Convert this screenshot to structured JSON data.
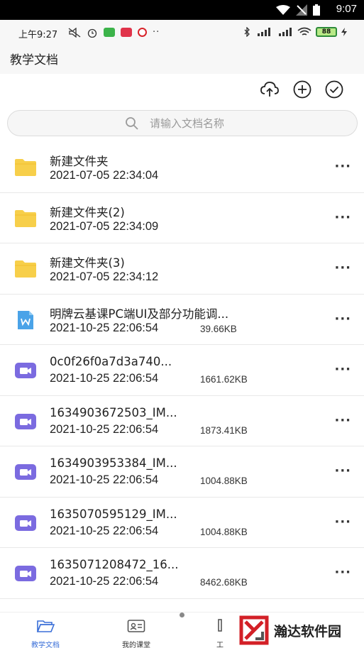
{
  "android_status": {
    "time": "9:07"
  },
  "phone_status": {
    "time": "上午9:27",
    "more": "··",
    "battery": "88"
  },
  "header": {
    "title": "教学文档"
  },
  "toolbar": {
    "upload_icon": "cloud-upload-icon",
    "add_icon": "plus-circle-icon",
    "select_icon": "check-circle-icon"
  },
  "search": {
    "placeholder": "请输入文档名称"
  },
  "files": [
    {
      "name": "新建文件夹",
      "date": "2021-07-05 22:34:04",
      "size": "",
      "type": "folder"
    },
    {
      "name": "新建文件夹(2)",
      "date": "2021-07-05 22:34:09",
      "size": "",
      "type": "folder"
    },
    {
      "name": "新建文件夹(3)",
      "date": "2021-07-05 22:34:12",
      "size": "",
      "type": "folder"
    },
    {
      "name": "明牌云基课PC端UI及部分功能调...",
      "date": "2021-10-25 22:06:54",
      "size": "39.66KB",
      "type": "word"
    },
    {
      "name": "0c0f26f0a7d3a740...",
      "date": "2021-10-25 22:06:54",
      "size": "1661.62KB",
      "type": "video"
    },
    {
      "name": "1634903672503_IM...",
      "date": "2021-10-25 22:06:54",
      "size": "1873.41KB",
      "type": "video"
    },
    {
      "name": "1634903953384_IM...",
      "date": "2021-10-25 22:06:54",
      "size": "1004.88KB",
      "type": "video"
    },
    {
      "name": "1635070595129_IM...",
      "date": "2021-10-25 22:06:54",
      "size": "1004.88KB",
      "type": "video"
    },
    {
      "name": "1635071208472_16...",
      "date": "2021-10-25 22:06:54",
      "size": "8462.68KB",
      "type": "video"
    }
  ],
  "more_label": "···",
  "bottom_nav": [
    {
      "label": "教学文档",
      "icon": "folder-open-icon",
      "active": true
    },
    {
      "label": "我的课堂",
      "icon": "id-card-icon",
      "active": false
    },
    {
      "label": "工",
      "icon": "tool-icon",
      "active": false
    }
  ],
  "watermark": {
    "text": "瀚达软件园"
  },
  "colors": {
    "folder": "#f7cf4a",
    "video": "#7b6be0",
    "word": "#4aa3e8",
    "active_nav": "#3a6fd8"
  }
}
